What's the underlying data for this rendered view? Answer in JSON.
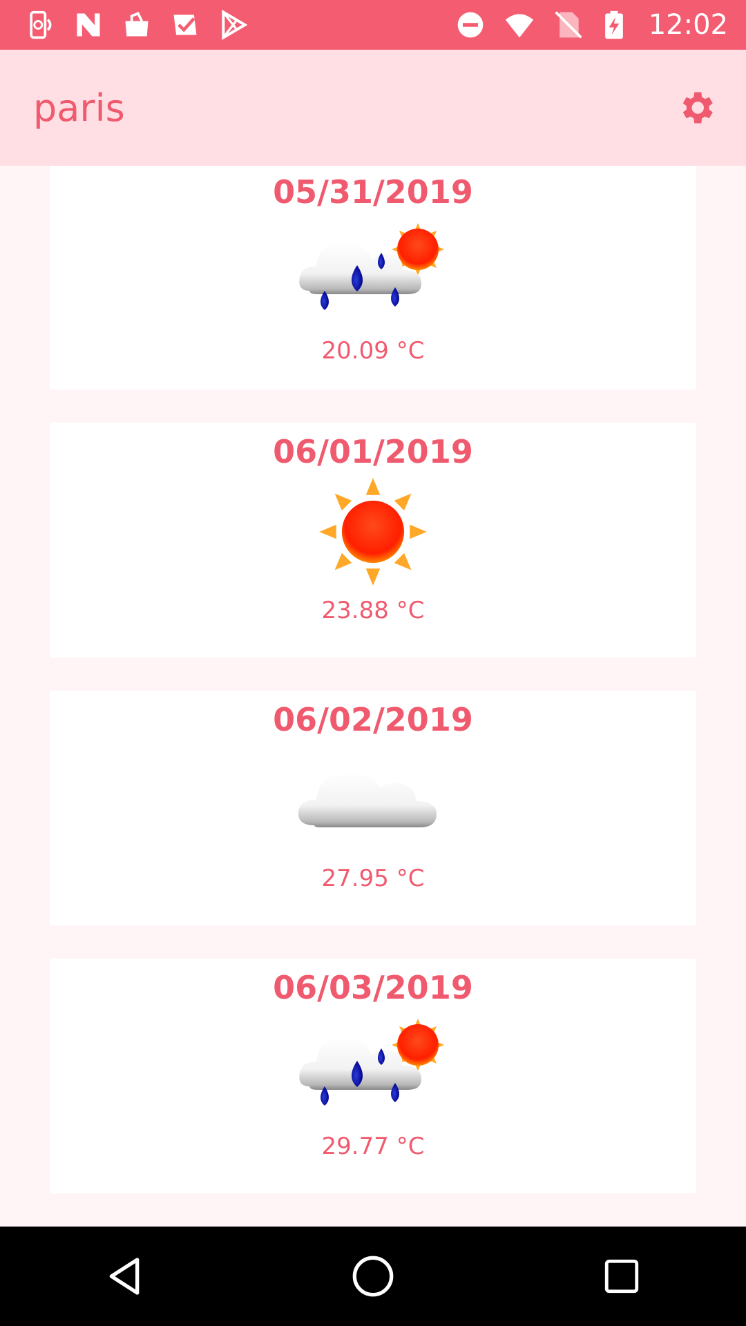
{
  "status_bar": {
    "time": "12:02",
    "left_icons": [
      "phone-sync-icon",
      "n-logo-icon",
      "bag-icon",
      "check-mail-icon",
      "play-store-icon"
    ],
    "right_icons": [
      "do-not-disturb-icon",
      "wifi-icon",
      "no-sim-icon",
      "battery-charging-icon"
    ]
  },
  "app_bar": {
    "title": "paris",
    "settings_icon": "gear-icon"
  },
  "forecast": [
    {
      "date": "05/31/2019",
      "icon": "rain-sun-icon",
      "temp": "20.09 °C"
    },
    {
      "date": "06/01/2019",
      "icon": "sun-icon",
      "temp": "23.88 °C"
    },
    {
      "date": "06/02/2019",
      "icon": "cloud-icon",
      "temp": "27.95 °C"
    },
    {
      "date": "06/03/2019",
      "icon": "rain-sun-icon",
      "temp": "29.77 °C"
    }
  ],
  "colors": {
    "status_bar": "#f45c71",
    "app_bar": "#ffdfe4",
    "accent": "#f05a6e",
    "background": "#fff4f6"
  }
}
